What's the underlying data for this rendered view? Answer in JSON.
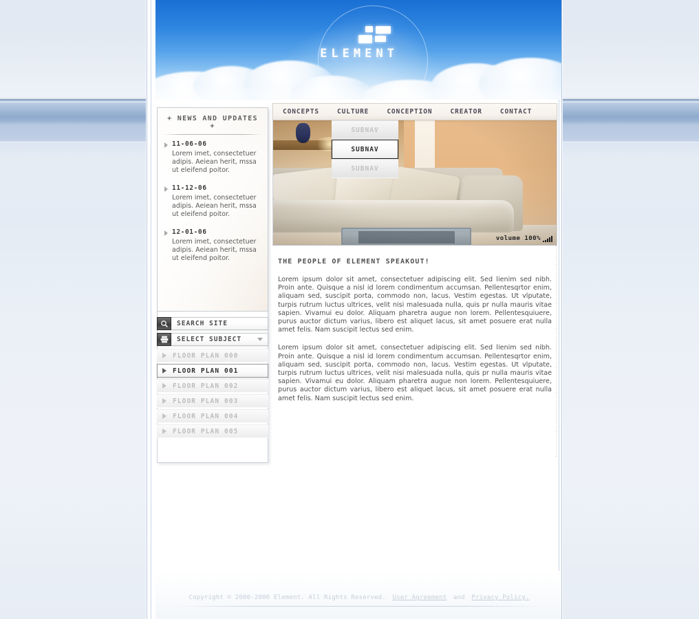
{
  "site": {
    "brand": "ELEMENT",
    "logo_icon": "element-blocks-logo"
  },
  "nav": {
    "items": [
      {
        "label": "CONCEPTS"
      },
      {
        "label": "CULTURE"
      },
      {
        "label": "CONCEPTION"
      },
      {
        "label": "CREATOR"
      },
      {
        "label": "CONTACT"
      }
    ]
  },
  "subnav": {
    "items": [
      {
        "label": "SUBNAV",
        "active": false
      },
      {
        "label": "SUBNAV",
        "active": true
      },
      {
        "label": "SUBNAV",
        "active": false
      }
    ]
  },
  "news": {
    "heading": "+  NEWS AND UPDATES  +",
    "items": [
      {
        "date": "11-06-06",
        "body": "Lorem imet, consectetuer adipis. Aeiean herit, mssa ut eleifend poitor."
      },
      {
        "date": "11-12-06",
        "body": "Lorem imet, consectetuer adipis. Aeiean herit, mssa ut eleifend poitor."
      },
      {
        "date": "12-01-06",
        "body": "Lorem imet, consectetuer adipis. Aeiean herit, mssa ut eleifend poitor."
      }
    ]
  },
  "tools": {
    "search": {
      "label": "SEARCH SITE",
      "icon": "magnifier-icon"
    },
    "select": {
      "label": "SELECT SUBJECT",
      "icon": "list-icon",
      "caret": "chevron-down-icon"
    }
  },
  "plans": {
    "items": [
      {
        "label": "FLOOR PLAN 000",
        "active": false
      },
      {
        "label": "FLOOR PLAN 001",
        "active": true
      },
      {
        "label": "FLOOR PLAN 002",
        "active": false
      },
      {
        "label": "FLOOR PLAN 003",
        "active": false
      },
      {
        "label": "FLOOR PLAN 004",
        "active": false
      },
      {
        "label": "FLOOR PLAN 005",
        "active": false
      }
    ]
  },
  "hero": {
    "volume_label": "volume 100%",
    "volume_level": 100
  },
  "article": {
    "title": "THE PEOPLE OF ELEMENT SPEAKOUT!",
    "paragraphs": [
      "Lorem ipsum dolor sit amet, consectetuer adipiscing elit. Sed lienim sed nibh. Proin ante. Quisque a nisl id lorem condimentum accumsan. Pellentesqrtor enim, aliquam sed, suscipit porta, commodo non, lacus. Vestim egestas. Ut vlputate, turpis rutrum luctus ultrices, velit nisi malesuada nulla, quis pr nulla mauris vitae sapien. Vivamui eu dolor. Aliquam pharetra augue non lorem. Pellentesquiuere, purus auctor dictum varius, libero est aliquet lacus, sit amet posuere erat nulla  amet felis. Nam suscipit lectus sed enim.",
      "Lorem ipsum dolor sit amet, consectetuer adipiscing elit. Sed lienim sed nibh. Proin ante. Quisque a nisl id lorem condimentum accumsan. Pellentesqrtor enim, aliquam sed, suscipit porta, commodo non, lacus. Vestim egestas. Ut vlputate, turpis rutrum luctus ultrices, velit nisi malesuada nulla, quis pr nulla mauris vitae sapien. Vivamui eu dolor. Aliquam pharetra augue non lorem. Pellentesquiuere, purus auctor dictum varius, libero est aliquet lacus, sit amet posuere erat nulla  amet felis. Nam suscipit lectus sed enim."
    ]
  },
  "footer": {
    "copyright": "Copyright © 2000-2006 Element. All Rights Reserved.",
    "user_agreement": "User Agreement",
    "and": "and",
    "privacy_policy": "Privacy Policy."
  },
  "colors": {
    "sky_top": "#1a6fd4",
    "sky_bottom": "#d6e9fb",
    "page_bg": "#e4ebf4",
    "band_blue": "#8faace",
    "nav_text": "#4c4a58",
    "muted": "#bdbdbd",
    "active_text": "#2e2e2e"
  }
}
